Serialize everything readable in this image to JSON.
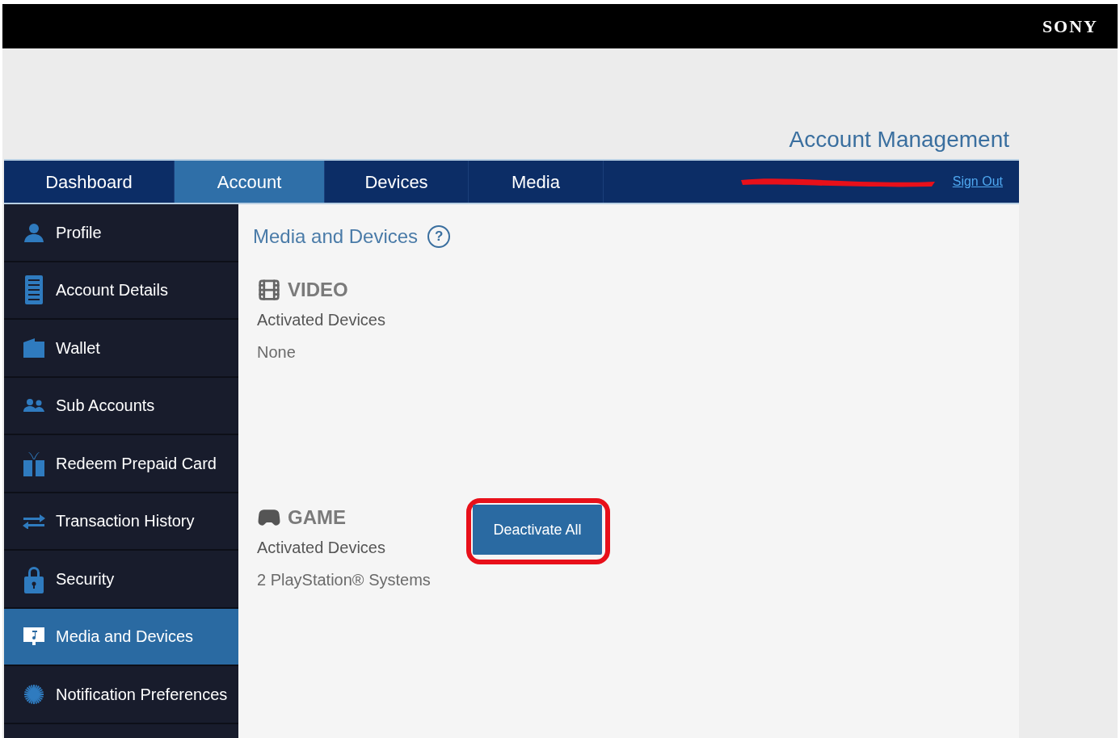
{
  "brand": "SONY",
  "page_title": "Account Management",
  "nav_tabs": [
    {
      "label": "Dashboard",
      "selected": false
    },
    {
      "label": "Account",
      "selected": true
    },
    {
      "label": "Devices",
      "selected": false
    },
    {
      "label": "Media",
      "selected": false
    }
  ],
  "sign_out": "Sign Out",
  "sidebar": [
    {
      "label": "Profile",
      "selected": false
    },
    {
      "label": "Account Details",
      "selected": false
    },
    {
      "label": "Wallet",
      "selected": false
    },
    {
      "label": "Sub Accounts",
      "selected": false
    },
    {
      "label": "Redeem Prepaid Card",
      "selected": false
    },
    {
      "label": "Transaction History",
      "selected": false
    },
    {
      "label": "Security",
      "selected": false
    },
    {
      "label": "Media and Devices",
      "selected": true
    },
    {
      "label": "Notification Preferences",
      "selected": false
    }
  ],
  "content": {
    "heading": "Media and Devices",
    "help": "?",
    "sections": [
      {
        "kind": "video",
        "title": "VIDEO",
        "label": "Activated Devices",
        "value": "None"
      },
      {
        "kind": "game",
        "title": "GAME",
        "label": "Activated Devices",
        "value": "2 PlayStation® Systems",
        "button": "Deactivate All"
      }
    ]
  }
}
